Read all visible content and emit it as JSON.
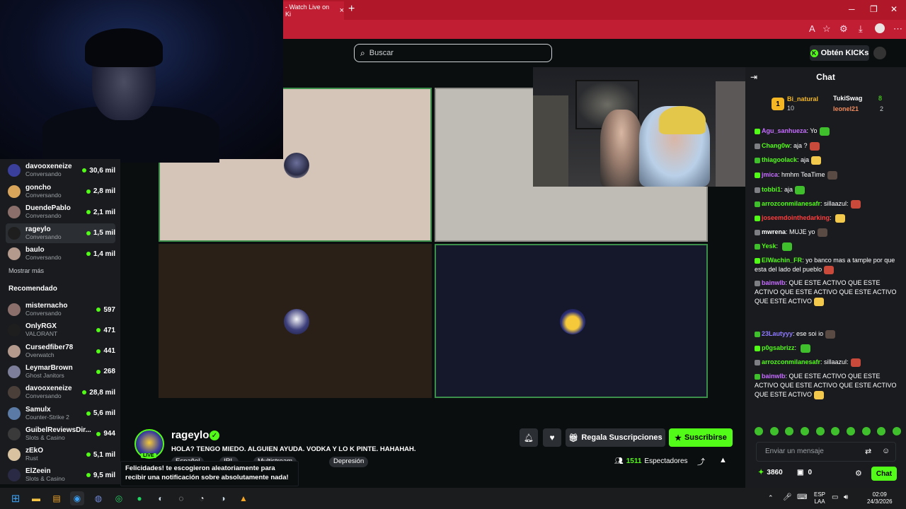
{
  "browser": {
    "tab_title": "- Watch Live on Ki",
    "tab_close": "×",
    "new_tab": "+"
  },
  "header": {
    "search_placeholder": "Buscar",
    "kicks_button": "Obtén KICKs"
  },
  "sidebar": {
    "following": [
      {
        "name": "davooxeneize",
        "category": "Conversando",
        "viewers": "30,6 mil"
      },
      {
        "name": "goncho",
        "category": "Conversando",
        "viewers": "2,8 mil"
      },
      {
        "name": "DuendePablo",
        "category": "Conversando",
        "viewers": "2,1 mil"
      },
      {
        "name": "rageylo",
        "category": "Conversando",
        "viewers": "1,5 mil"
      },
      {
        "name": "baulo",
        "category": "Conversando",
        "viewers": "1,4 mil"
      }
    ],
    "show_more": "Mostrar más",
    "recommended_title": "Recomendado",
    "recommended": [
      {
        "name": "misternacho",
        "category": "Conversando",
        "viewers": "597"
      },
      {
        "name": "OnlyRGX",
        "category": "VALORANT",
        "viewers": "471"
      },
      {
        "name": "Cursedfiber78",
        "category": "Overwatch",
        "viewers": "441"
      },
      {
        "name": "LeymarBrown",
        "category": "Ghost Janitors",
        "viewers": "268"
      },
      {
        "name": "davooxeneize",
        "category": "Conversando",
        "viewers": "28,8 mil"
      },
      {
        "name": "Samulx",
        "category": "Counter-Strike 2",
        "viewers": "5,6 mil"
      },
      {
        "name": "GuibelReviewsDir...",
        "category": "Slots & Casino",
        "viewers": "944"
      },
      {
        "name": "zEkO",
        "category": "Rust",
        "viewers": "5,1 mil"
      },
      {
        "name": "ElZeein",
        "category": "Slots & Casino",
        "viewers": "9,5 mil"
      }
    ]
  },
  "stream": {
    "streamer": "rageylo",
    "live_label": "LIVE",
    "title": "HOLA? TENGO MIEDO. ALGUIEN AYUDA. VODKA Y LO K PINTE. HAHAHAH.",
    "tags": [
      "Español",
      "IRL",
      "Multistream",
      "Depresión"
    ],
    "viewers_count": "1511",
    "viewers_label": "Espectadores",
    "gift_button": "Regala Suscripciones",
    "subscribe_button": "Suscribirse"
  },
  "notification": {
    "text": "Felicidades! te escogieron aleatoriamente para recibir una notificación sobre absolutamente nada!"
  },
  "chat": {
    "title": "Chat",
    "gifters": [
      {
        "name": "Bi_natural",
        "count": "10"
      },
      {
        "name": "TukiSwag",
        "count": "8"
      },
      {
        "name": "leonel21",
        "count": "2"
      }
    ],
    "messages": [
      {
        "user": "Agu_sanhueza",
        "color": "#c66cff",
        "text": "Yo"
      },
      {
        "user": "Chang0w",
        "color": "#53fc18",
        "text": "aja ?"
      },
      {
        "user": "thiagoolack",
        "color": "#53fc18",
        "text": "aja"
      },
      {
        "user": "jmica",
        "color": "#c66cff",
        "text": "hmhm TeaTime"
      },
      {
        "user": "tobbi1",
        "color": "#53fc18",
        "text": "aja"
      },
      {
        "user": "arrozconmilanesafr",
        "color": "#53fc18",
        "text": "sillaazul:"
      },
      {
        "user": "joseemdointhedarking",
        "color": "#ff3d3d",
        "text": ""
      },
      {
        "user": "mwrena",
        "color": "#ffffff",
        "text": "MUJE yo"
      },
      {
        "user": "Yesk",
        "color": "#53fc18",
        "text": ""
      },
      {
        "user": "ElWachin_FR",
        "color": "#53fc18",
        "text": "yo banco mas a tample por que esta del lado del pueblo"
      },
      {
        "user": "bainwlb",
        "color": "#c66cff",
        "text": "QUE ESTE ACTIVO QUE ESTE ACTIVO QUE ESTE ACTIVO QUE ESTE ACTIVO QUE ESTE ACTIVO"
      },
      {
        "user": "23Lautyyy",
        "color": "#8f7bff",
        "text": "ese soi io"
      },
      {
        "user": "p0gsabrizz",
        "color": "#53fc18",
        "text": ""
      },
      {
        "user": "arrozconmilanesafr",
        "color": "#53fc18",
        "text": "sillaazul:"
      },
      {
        "user": "bainwlb",
        "color": "#c66cff",
        "text": "QUE ESTE ACTIVO QUE ESTE ACTIVO QUE ESTE ACTIVO QUE ESTE ACTIVO QUE ESTE ACTIVO"
      }
    ],
    "input_placeholder": "Enviar un mensaje",
    "points": "3860",
    "slots": "0",
    "send_button": "Chat"
  },
  "taskbar": {
    "lang_line1": "ESP",
    "lang_line2": "LAA",
    "time": "02:09",
    "date": "24/3/2026"
  },
  "colors": {
    "accent": "#53fc18",
    "browser": "#c21e33",
    "background": "#0b0e0f",
    "panel": "#191b1f"
  }
}
